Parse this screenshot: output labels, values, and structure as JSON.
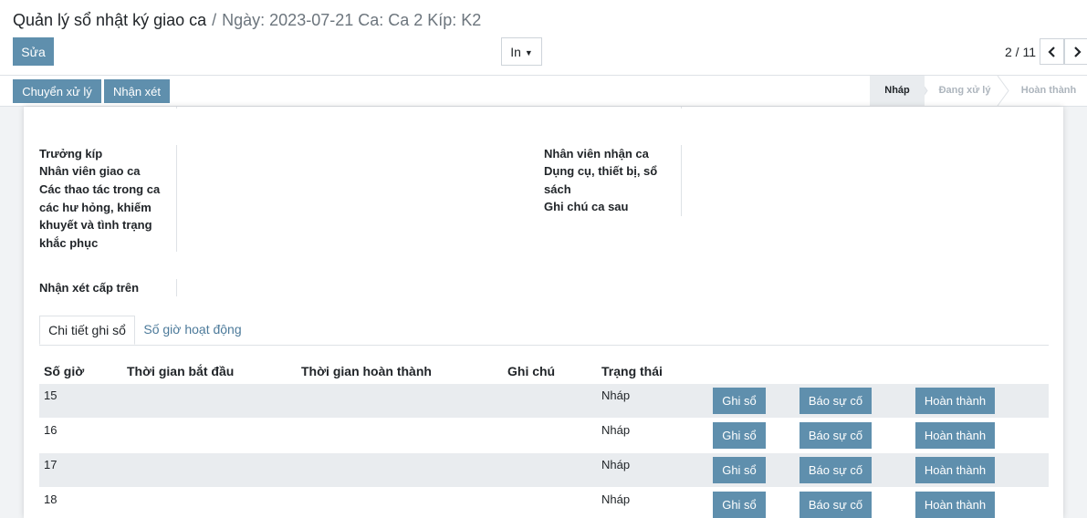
{
  "breadcrumb": {
    "root": "Quản lý sổ nhật ký giao ca",
    "separator": "/",
    "current": "Ngày: 2023-07-21 Ca: Ca 2 Kíp: K2"
  },
  "toolbar": {
    "edit_label": "Sửa",
    "print_label": "In",
    "pager": "2 / 11"
  },
  "statusbar": {
    "buttons": [
      "Chuyển xử lý",
      "Nhận xét"
    ],
    "stages": [
      {
        "label": "Nháp",
        "active": true
      },
      {
        "label": "Đang xử lý",
        "active": false
      },
      {
        "label": "Hoàn thành",
        "active": false
      }
    ]
  },
  "form": {
    "left_labels": [
      "Trưởng kíp",
      "Nhân viên giao ca",
      "Các thao tác trong ca các hư hỏng, khiếm khuyết và tình trạng khắc phục"
    ],
    "right_labels": [
      "Nhân viên nhận ca",
      "Dụng cụ, thiết bị, sổ sách",
      "Ghi chú ca sau"
    ],
    "supervisor_label": "Nhận xét cấp trên"
  },
  "tabs": [
    "Chi tiết ghi sổ",
    "Số giờ hoạt động"
  ],
  "table": {
    "headers": [
      "Số giờ",
      "Thời gian bắt đầu",
      "Thời gian hoàn thành",
      "Ghi chú",
      "Trạng thái"
    ],
    "rows": [
      {
        "hour": "15",
        "status": "Nháp"
      },
      {
        "hour": "16",
        "status": "Nháp"
      },
      {
        "hour": "17",
        "status": "Nháp"
      },
      {
        "hour": "18",
        "status": "Nháp"
      }
    ],
    "row_buttons": [
      "Ghi sổ",
      "Báo sự cố",
      "Hoàn thành"
    ]
  },
  "colors": {
    "primary": "#5f8fad",
    "row_alt": "#e9ecef",
    "link": "#4c7a9a"
  }
}
